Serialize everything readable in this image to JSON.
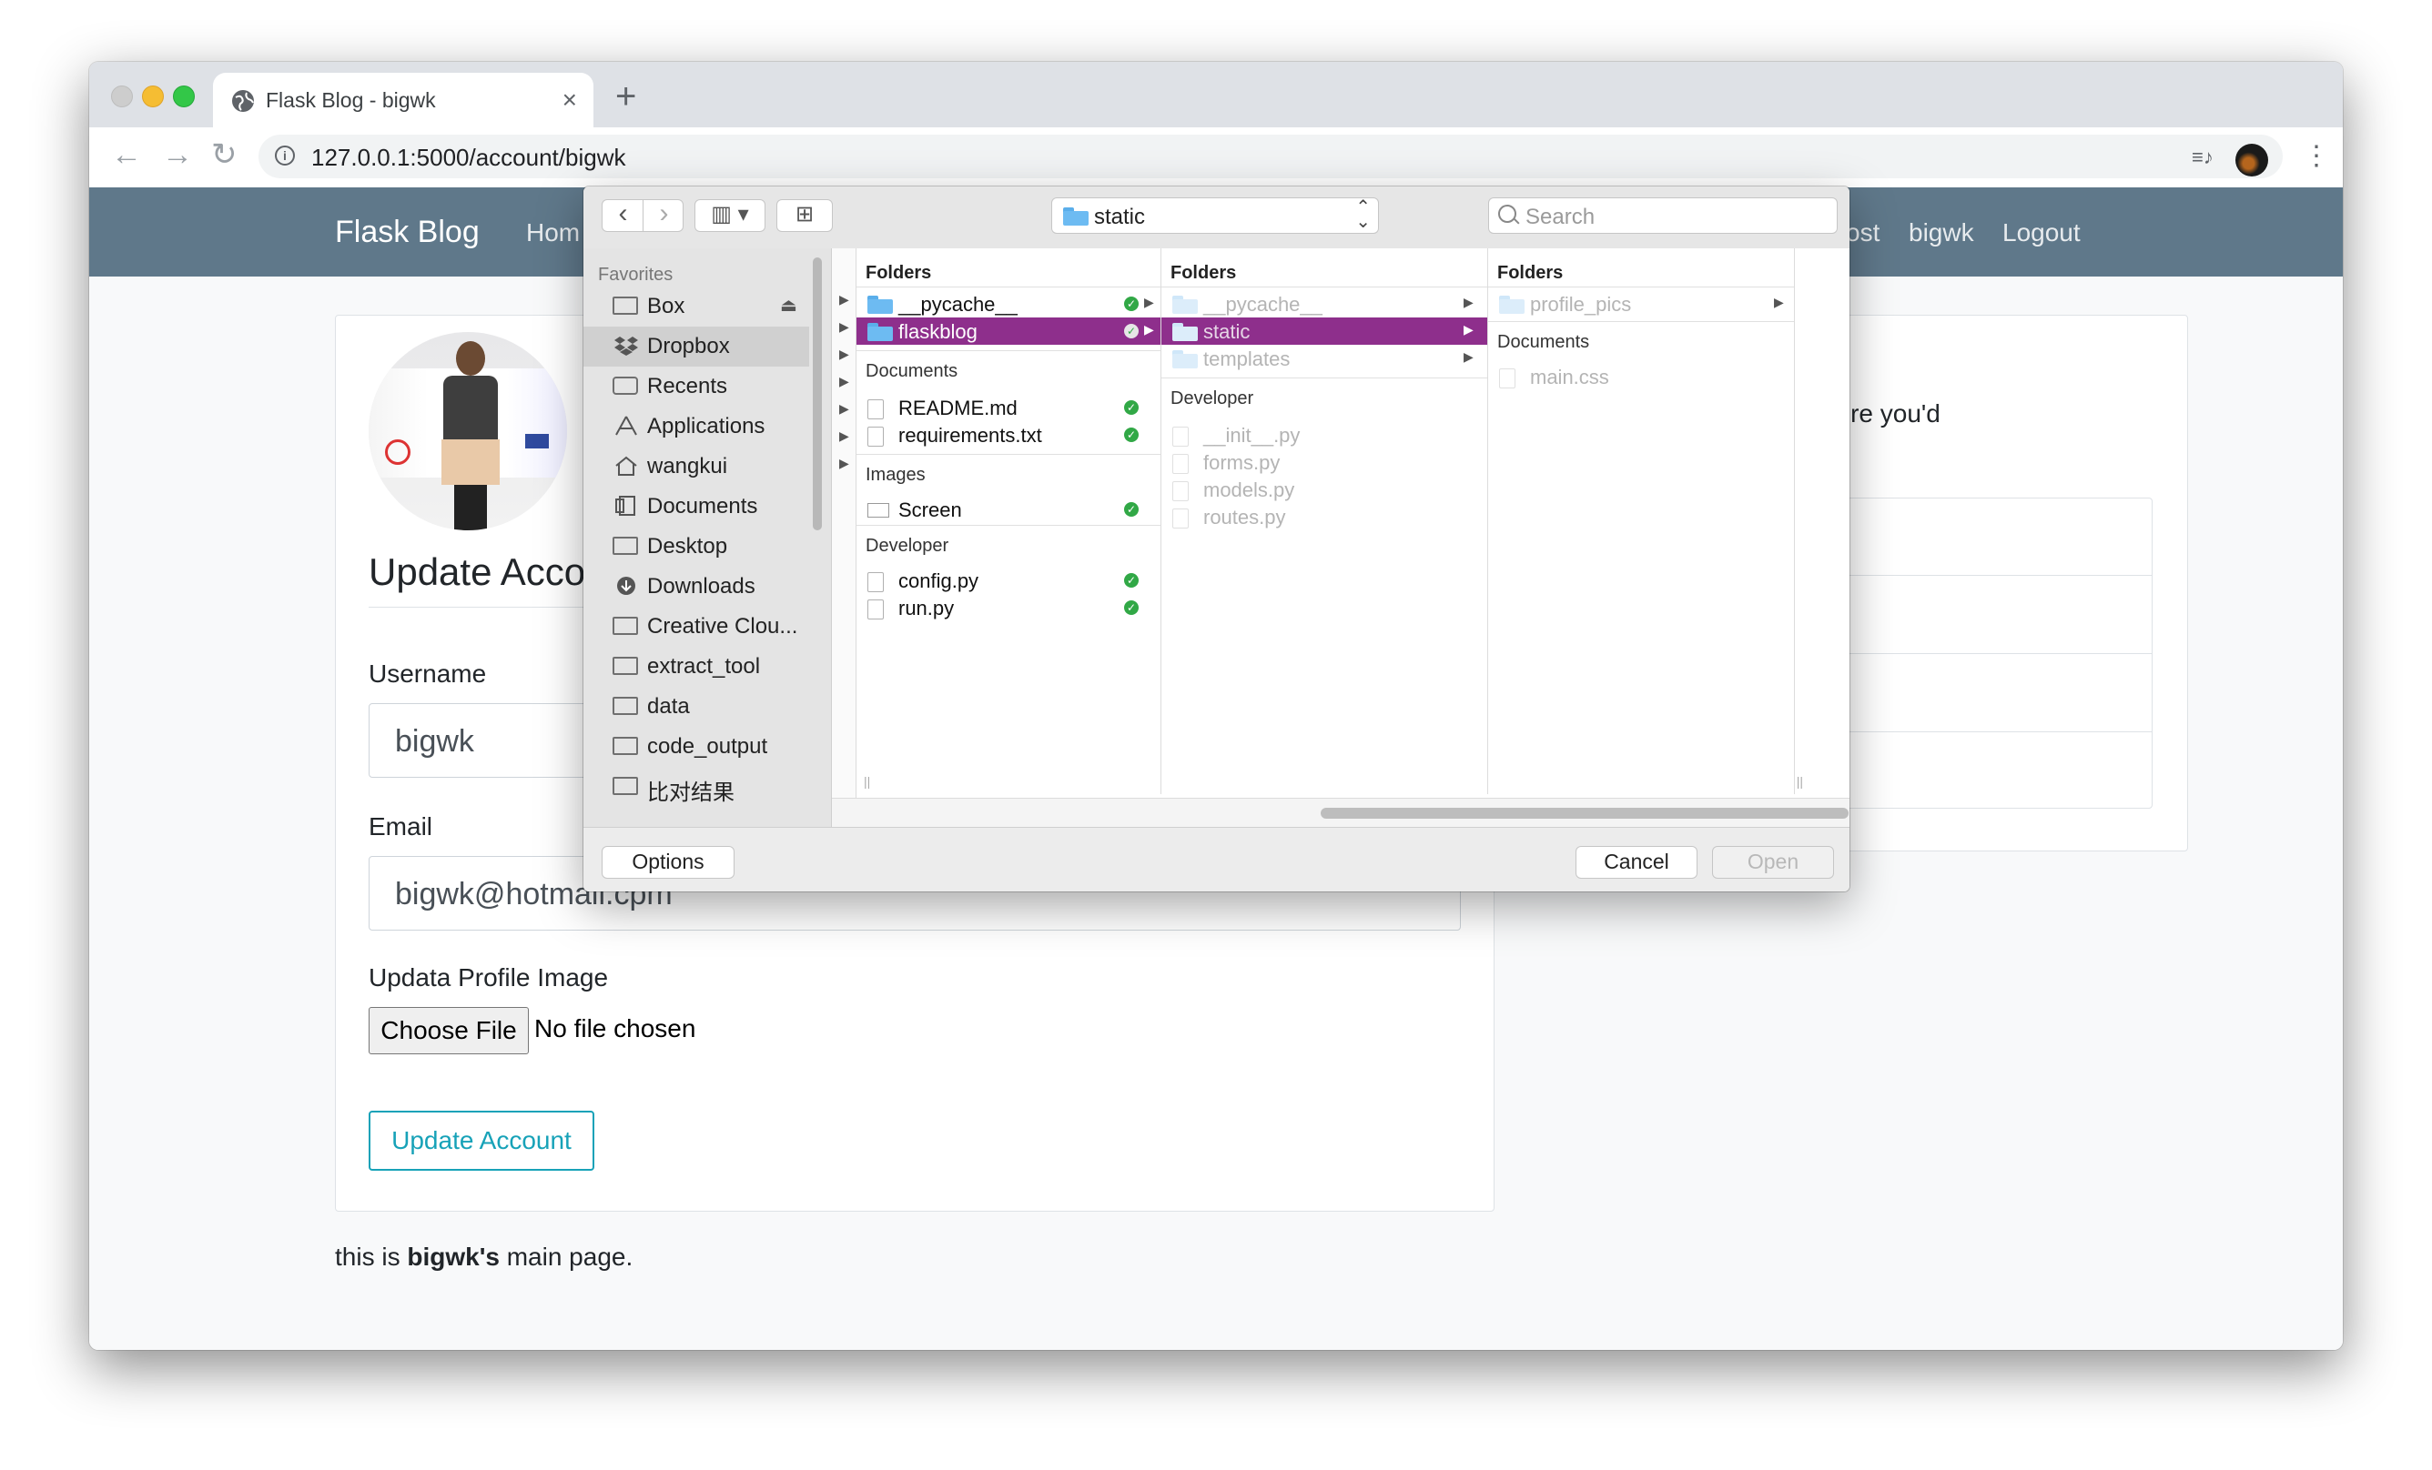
{
  "browser": {
    "tab_title": "Flask Blog - bigwk",
    "tab_close": "×",
    "new_tab": "+",
    "url": "127.0.0.1:5000/account/bigwk",
    "back": "←",
    "forward": "→",
    "reload": "↻",
    "star": "☆",
    "menu": "⋮",
    "media": "≡♪"
  },
  "navbar": {
    "brand": "Flask Blog",
    "home": "Hom",
    "new_post": "ost",
    "user": "bigwk",
    "logout": "Logout"
  },
  "account": {
    "title": "Update Acco",
    "username_label": "Username",
    "username_value": "bigwk",
    "email_label": "Email",
    "email_value": "bigwk@hotmail.cpm",
    "image_label": "Updata Profile Image",
    "choose_file": "Choose File",
    "no_file": "No file chosen",
    "submit": "Update Account"
  },
  "footer_text": {
    "prefix": "this is ",
    "name": "bigwk's",
    "suffix": " main page."
  },
  "sidebar_card": {
    "text": "tion here you'd"
  },
  "dialog": {
    "location": "static",
    "search_placeholder": "Search",
    "view_toggle": "▥ ▾",
    "new_folder": "⊞",
    "nav_back": "‹",
    "nav_forward": "›",
    "favorites_heading": "Favorites",
    "favorites": [
      "Box",
      "Dropbox",
      "Recents",
      "Applications",
      "wangkui",
      "Documents",
      "Desktop",
      "Downloads",
      "Creative Clou...",
      "extract_tool",
      "data",
      "code_output",
      "比对结果"
    ],
    "selected_favorite": "Dropbox",
    "col1": {
      "folders_heading": "Folders",
      "folders": [
        "__pycache__",
        "flaskblog"
      ],
      "documents_heading": "Documents",
      "documents": [
        "README.md",
        "requirements.txt"
      ],
      "images_heading": "Images",
      "images": [
        "Screen"
      ],
      "developer_heading": "Developer",
      "developer": [
        "config.py",
        "run.py"
      ]
    },
    "col2": {
      "folders_heading": "Folders",
      "folders": [
        "__pycache__",
        "static",
        "templates"
      ],
      "developer_heading": "Developer",
      "developer": [
        "__init__.py",
        "forms.py",
        "models.py",
        "routes.py"
      ]
    },
    "col3": {
      "folders_heading": "Folders",
      "folders": [
        "profile_pics"
      ],
      "documents_heading": "Documents",
      "documents": [
        "main.css"
      ]
    },
    "options": "Options",
    "cancel": "Cancel",
    "open": "Open"
  },
  "colors": {
    "navbar": "#5f788a",
    "selection": "#8e2f8c",
    "button_outline": "#17a2b8",
    "sync_check": "#31a846"
  }
}
